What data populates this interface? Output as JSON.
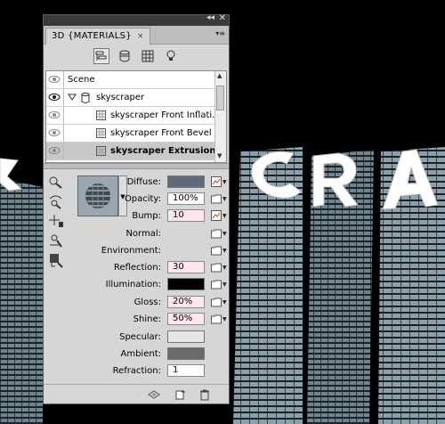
{
  "panel": {
    "collapse_glyph": "◂◂",
    "close_glyph": "✕",
    "tab_label": "3D {MATERIALS}",
    "tab_close_glyph": "×",
    "menu_glyph": "▾≡"
  },
  "filters": [
    {
      "icon": "whole-scene-icon"
    },
    {
      "icon": "meshes-icon"
    },
    {
      "icon": "materials-icon"
    },
    {
      "icon": "lights-icon"
    }
  ],
  "scene_list": {
    "rows": [
      {
        "label": "Scene"
      },
      {
        "label": "skyscraper"
      },
      {
        "label": "skyscraper Front Inflati..."
      },
      {
        "label": "skyscraper Front Bevel ..."
      },
      {
        "label": "skyscraper Extrusion..."
      }
    ]
  },
  "properties": {
    "diffuse": {
      "label": "Diffuse:",
      "color": "#5d6c78"
    },
    "opacity": {
      "label": "Opacity:",
      "value": "100%"
    },
    "bump": {
      "label": "Bump:",
      "value": "10"
    },
    "normal": {
      "label": "Normal:"
    },
    "environment": {
      "label": "Environment:"
    },
    "reflection": {
      "label": "Reflection:",
      "value": "30"
    },
    "illumination": {
      "label": "Illumination:",
      "color": "#000000"
    },
    "gloss": {
      "label": "Gloss:",
      "value": "20%"
    },
    "shine": {
      "label": "Shine:",
      "value": "50%"
    },
    "specular": {
      "label": "Specular:",
      "color": "#e6e6e6"
    },
    "ambient": {
      "label": "Ambient:",
      "color": "#6a6a6a"
    },
    "refraction": {
      "label": "Refraction:",
      "value": "1"
    }
  },
  "colors": {
    "panel_bg": "#d6d6d6",
    "titlebar": "#3a3a3a",
    "field_pink": "#fde6ee",
    "selected_row": "#c8c8c8",
    "building_teal": "#7e929c"
  }
}
